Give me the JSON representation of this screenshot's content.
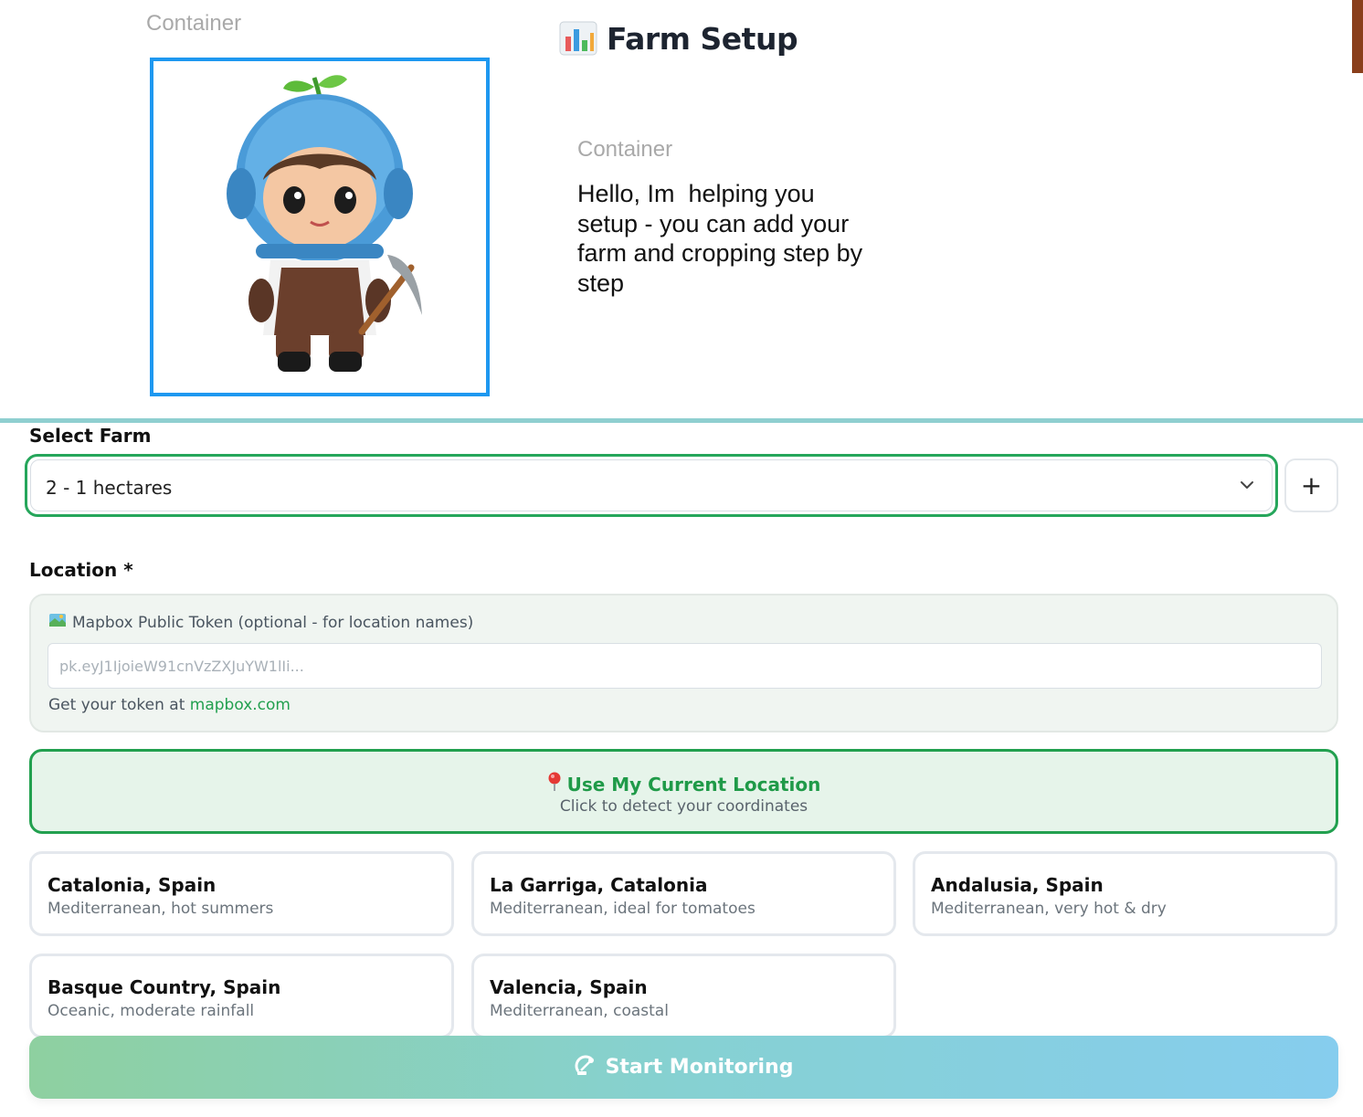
{
  "header": {
    "container_label_left": "Container",
    "title": "Farm Setup",
    "title_icon": "bar-chart-icon",
    "container_label_right": "Container",
    "greeting": "Hello, Im  helping you\nsetup - you can add your\nfarm and cropping step by\nstep"
  },
  "avatar": {
    "icon": "farmer-mascot-icon",
    "frame_color": "#1e98f0"
  },
  "farm": {
    "label": "Select Farm",
    "selected": "2 - 1 hectares",
    "add_label": "+"
  },
  "location": {
    "label": "Location *",
    "token_label": "Mapbox Public Token (optional - for location names)",
    "token_icon": "map-icon",
    "token_placeholder": "pk.eyJ1IjoieW91cnVzZXJuYW1lIi...",
    "token_help_prefix": "Get your token at ",
    "token_help_link": "mapbox.com",
    "current_location_title": "Use My Current Location",
    "current_location_icon": "pin-icon",
    "current_location_subtitle": "Click to detect your coordinates",
    "presets": [
      {
        "name": "Catalonia, Spain",
        "desc": "Mediterranean, hot summers"
      },
      {
        "name": "La Garriga, Catalonia",
        "desc": "Mediterranean, ideal for tomatoes"
      },
      {
        "name": "Andalusia, Spain",
        "desc": "Mediterranean, very hot & dry"
      },
      {
        "name": "Basque Country, Spain",
        "desc": "Oceanic, moderate rainfall"
      },
      {
        "name": "Valencia, Spain",
        "desc": "Mediterranean, coastal"
      }
    ]
  },
  "actions": {
    "start_label": "Start Monitoring",
    "start_icon": "satellite-icon"
  },
  "colors": {
    "accent_green": "#22a04f",
    "divider": "#8fcfd0"
  }
}
